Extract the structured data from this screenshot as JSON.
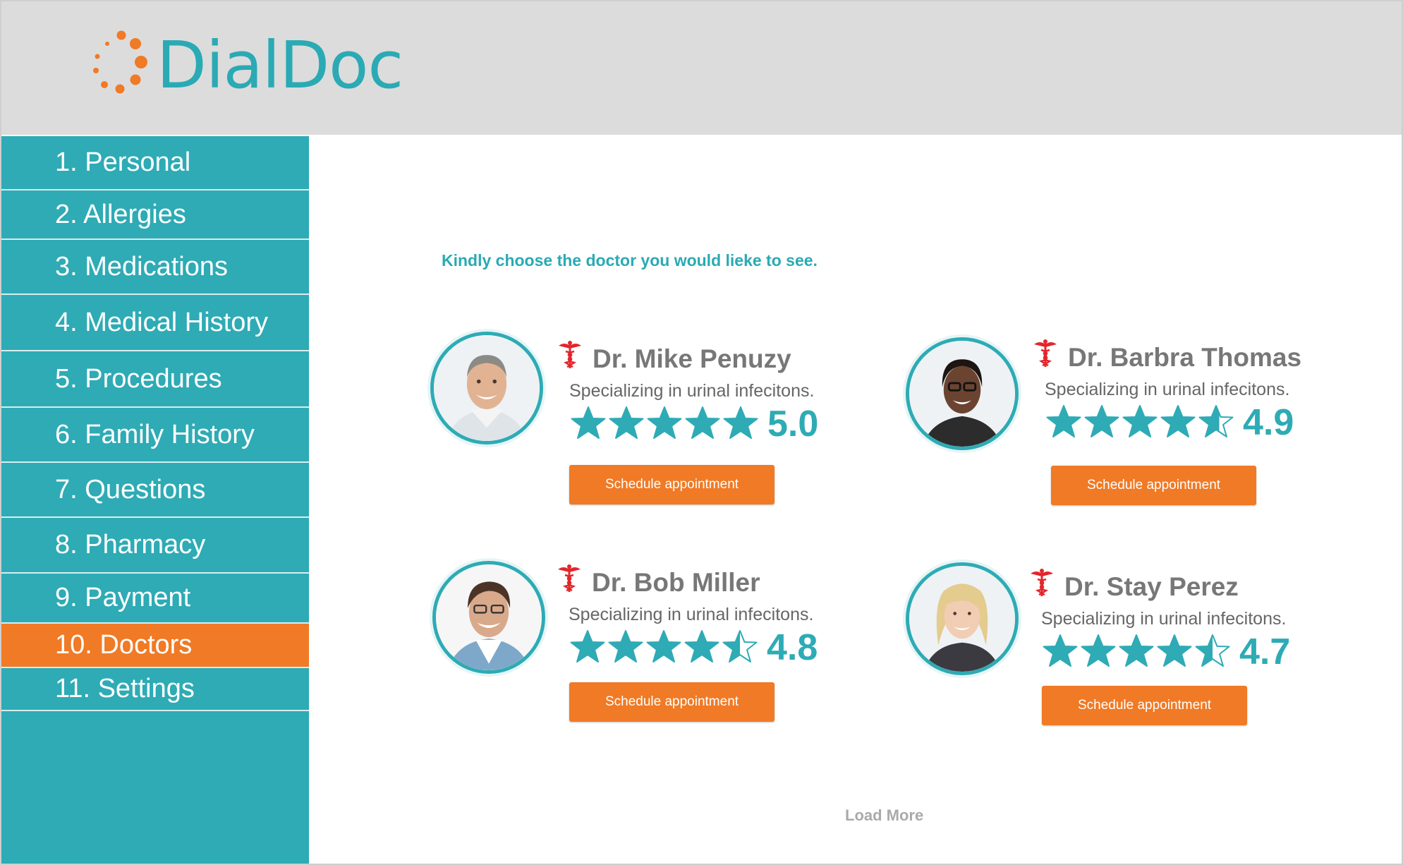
{
  "app": {
    "logo_text": "DialDoc"
  },
  "sidebar": {
    "items": [
      {
        "label": "1. Personal",
        "active": false
      },
      {
        "label": "2. Allergies",
        "active": false
      },
      {
        "label": "3. Medications",
        "active": false
      },
      {
        "label": "4. Medical History",
        "active": false
      },
      {
        "label": "5. Procedures",
        "active": false
      },
      {
        "label": "6. Family History",
        "active": false
      },
      {
        "label": "7. Questions",
        "active": false
      },
      {
        "label": "8. Pharmacy",
        "active": false
      },
      {
        "label": "9. Payment",
        "active": false
      },
      {
        "label": "10. Doctors",
        "active": true
      },
      {
        "label": "11. Settings",
        "active": false
      }
    ]
  },
  "main": {
    "prompt": "Kindly choose the doctor you would lieke to see.",
    "doctors": [
      {
        "name": "Dr. Mike Penuzy",
        "specialty": "Specializing in urinal infecitons.",
        "rating": "5.0",
        "stars": 5.0,
        "button": "Schedule appointment"
      },
      {
        "name": "Dr. Barbra Thomas",
        "specialty": "Specializing in urinal infecitons.",
        "rating": "4.9",
        "stars": 4.9,
        "button": "Schedule appointment"
      },
      {
        "name": "Dr. Bob Miller",
        "specialty": "Specializing in urinal infecitons.",
        "rating": "4.8",
        "stars": 4.8,
        "button": "Schedule appointment"
      },
      {
        "name": "Dr. Stay Perez",
        "specialty": "Specializing in urinal infecitons.",
        "rating": "4.7",
        "stars": 4.7,
        "button": "Schedule appointment"
      }
    ],
    "load_more": "Load More"
  },
  "colors": {
    "brand_teal": "#2eabb5",
    "accent_orange": "#f07a25",
    "header_gray": "#dcdcdc",
    "caduceus_red": "#e3262b"
  },
  "icons": {
    "logo": "dot-ring-logo-icon",
    "specialty": "caduceus-icon",
    "rating": "star-icon"
  }
}
